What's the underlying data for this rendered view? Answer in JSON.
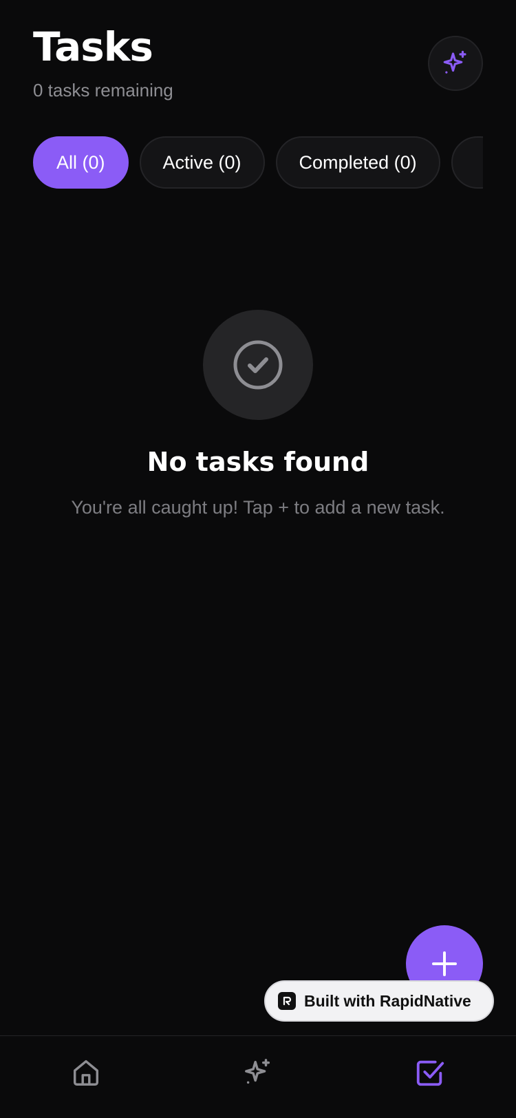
{
  "header": {
    "title": "Tasks",
    "subtitle": "0 tasks remaining",
    "ai_button_icon": "sparkles-icon"
  },
  "filters": [
    {
      "label": "All (0)",
      "selected": true
    },
    {
      "label": "Active (0)",
      "selected": false
    },
    {
      "label": "Completed (0)",
      "selected": false
    },
    {
      "label": "",
      "selected": false
    }
  ],
  "empty_state": {
    "icon": "check-circle-icon",
    "title": "No tasks found",
    "message": "You're all caught up! Tap + to add a new task."
  },
  "fab": {
    "icon": "plus-icon"
  },
  "badge": {
    "label": "Built with RapidNative"
  },
  "tabbar": {
    "items": [
      {
        "icon": "home-icon",
        "label": "",
        "active": false
      },
      {
        "icon": "sparkles-icon",
        "label": "",
        "active": false
      },
      {
        "icon": "checkbox-icon",
        "label": "",
        "active": true
      }
    ]
  },
  "colors": {
    "accent": "#8b5cf6",
    "background": "#0a0a0b",
    "muted": "#8e8e93"
  }
}
